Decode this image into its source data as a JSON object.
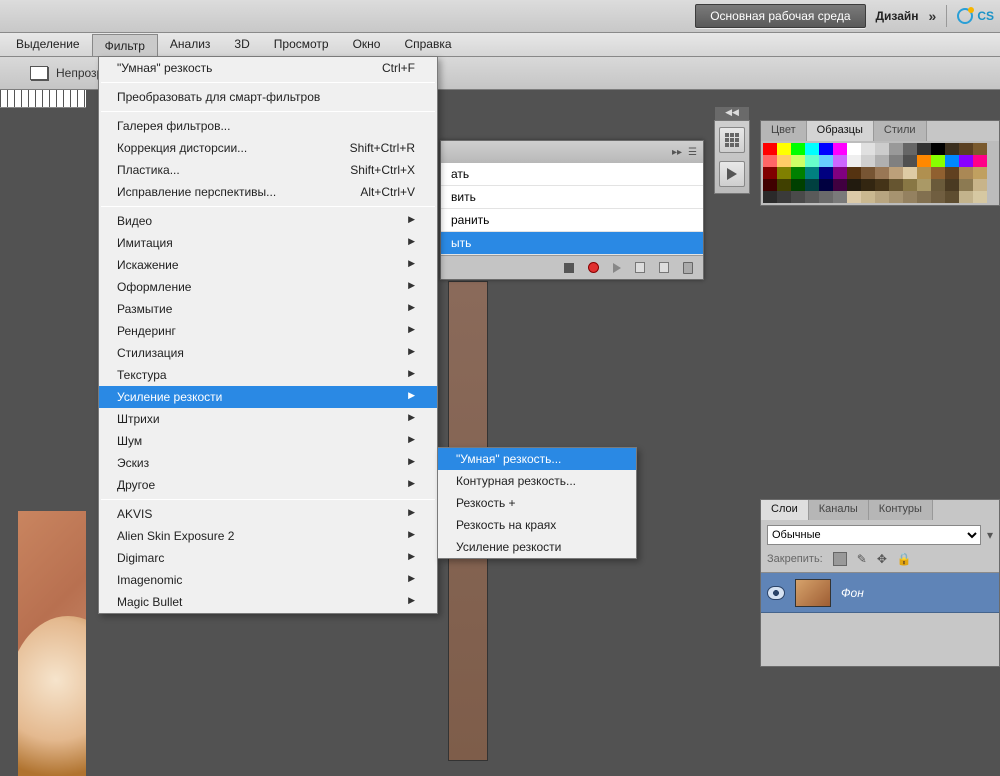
{
  "topbar": {
    "workspace_button": "Основная рабочая среда",
    "design_label": "Дизайн",
    "cs_label": "CS"
  },
  "menubar": {
    "items": [
      "Выделение",
      "Фильтр",
      "Анализ",
      "3D",
      "Просмотр",
      "Окно",
      "Справка"
    ],
    "active_index": 1
  },
  "optbar": {
    "opacity_label": "Непрозрач"
  },
  "filter_menu": {
    "smart_sharpen": "\"Умная\" резкость",
    "smart_sharpen_shortcut": "Ctrl+F",
    "convert_smart": "Преобразовать для смарт-фильтров",
    "gallery": "Галерея фильтров...",
    "lens": "Коррекция дисторсии...",
    "lens_shortcut": "Shift+Ctrl+R",
    "liquify": "Пластика...",
    "liquify_shortcut": "Shift+Ctrl+X",
    "vanishing": "Исправление перспективы...",
    "vanishing_shortcut": "Alt+Ctrl+V",
    "groups": [
      "Видео",
      "Имитация",
      "Искажение",
      "Оформление",
      "Размытие",
      "Рендеринг",
      "Стилизация",
      "Текстура",
      "Усиление резкости",
      "Штрихи",
      "Шум",
      "Эскиз",
      "Другое"
    ],
    "highlighted_group_index": 8,
    "plugins": [
      "AKVIS",
      "Alien Skin Exposure 2",
      "Digimarc",
      "Imagenomic",
      "Magic Bullet"
    ]
  },
  "sharpen_submenu": {
    "items": [
      "\"Умная\" резкость...",
      "Контурная резкость...",
      "Резкость +",
      "Резкость на краях",
      "Усиление резкости"
    ],
    "highlighted_index": 0
  },
  "actions_panel": {
    "visible_rows": [
      "ать",
      "вить",
      "ранить",
      "ыть"
    ],
    "selected_index": 3
  },
  "swatch_panel": {
    "tabs": [
      "Цвет",
      "Образцы",
      "Стили"
    ],
    "active_tab": 1,
    "colors": [
      "#ff0000",
      "#ffff00",
      "#00ff00",
      "#00ffff",
      "#0000ff",
      "#ff00ff",
      "#ffffff",
      "#e0e0e0",
      "#cccccc",
      "#999999",
      "#666666",
      "#333333",
      "#000000",
      "#3b2f1e",
      "#5a4022",
      "#7a5a2e",
      "#ff6666",
      "#ffcc66",
      "#ccff66",
      "#66ffcc",
      "#66ccff",
      "#cc66ff",
      "#efefef",
      "#d0d0d0",
      "#b0b0b0",
      "#808080",
      "#505050",
      "#ff8800",
      "#88ff00",
      "#0088ff",
      "#8800ff",
      "#ff0088",
      "#800000",
      "#808000",
      "#008000",
      "#008080",
      "#000080",
      "#800080",
      "#553311",
      "#775533",
      "#997755",
      "#bca07a",
      "#decba4",
      "#b09050",
      "#906030",
      "#604020",
      "#aa8855",
      "#c0a060",
      "#400000",
      "#404000",
      "#004000",
      "#004040",
      "#000040",
      "#400040",
      "#221b0f",
      "#332611",
      "#443318",
      "#665530",
      "#887744",
      "#aa9966",
      "#6a5a3a",
      "#4a3a22",
      "#8c7a52",
      "#c8b48a",
      "#2a2a2a",
      "#3a3a3a",
      "#4a4a4a",
      "#5a5a5a",
      "#6a6a6a",
      "#7a7a7a",
      "#dccaa8",
      "#cab890",
      "#b8a580",
      "#a69370",
      "#948160",
      "#827050",
      "#705e40",
      "#5e4d30",
      "#c3b38c",
      "#d6c8a2"
    ]
  },
  "layers_panel": {
    "tabs": [
      "Слои",
      "Каналы",
      "Контуры"
    ],
    "active_tab": 0,
    "blend_mode": "Обычные",
    "lock_label": "Закрепить:",
    "layer_name": "Фон"
  }
}
